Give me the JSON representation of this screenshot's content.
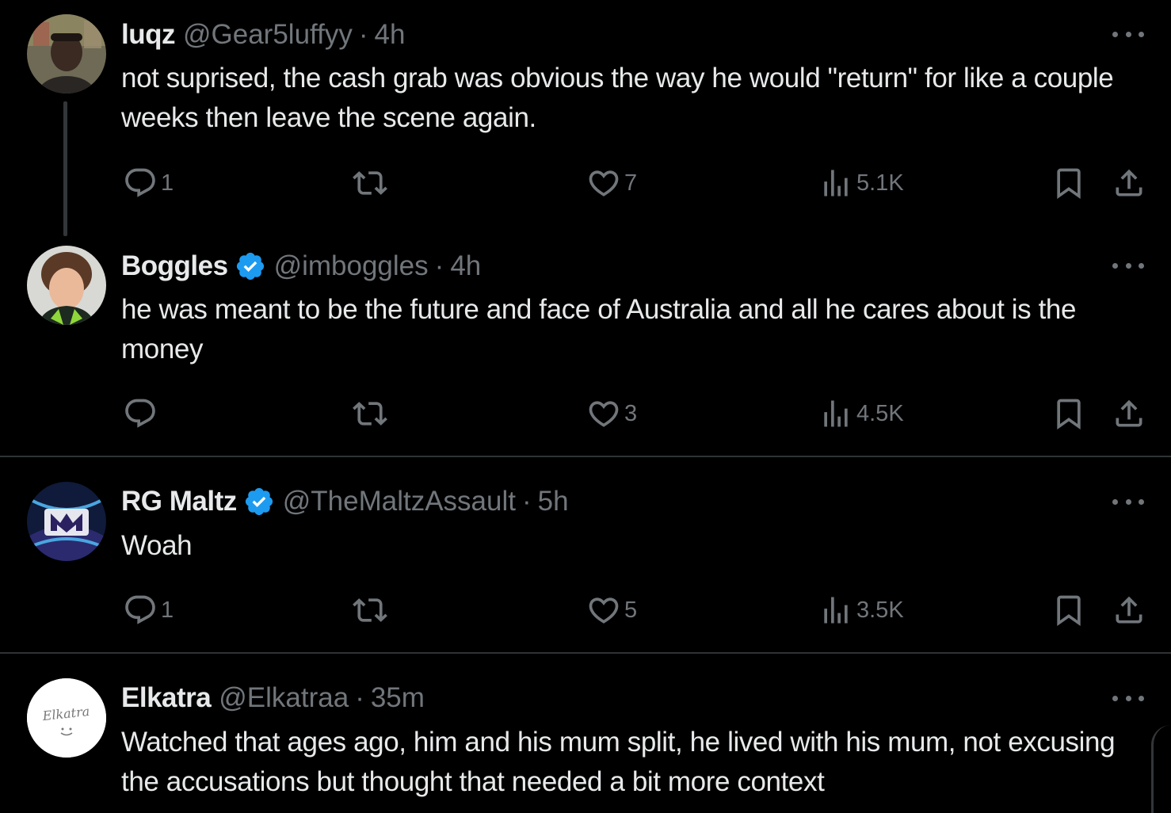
{
  "tweets": [
    {
      "name": "luqz",
      "handle": "@Gear5luffyy",
      "time": "4h",
      "verified": false,
      "text": "not suprised, the cash grab was obvious the way he would \"return\" for like a couple weeks then leave the scene again.",
      "replies": "1",
      "retweets": "",
      "likes": "7",
      "views": "5.1K"
    },
    {
      "name": "Boggles",
      "handle": "@imboggles",
      "time": "4h",
      "verified": true,
      "text": "he was meant to be the future and face of Australia and all he cares about is the money",
      "replies": "",
      "retweets": "",
      "likes": "3",
      "views": "4.5K"
    },
    {
      "name": "RG Maltz",
      "handle": "@TheMaltzAssault",
      "time": "5h",
      "verified": true,
      "text": "Woah",
      "replies": "1",
      "retweets": "",
      "likes": "5",
      "views": "3.5K"
    },
    {
      "name": "Elkatra",
      "handle": "@Elkatraa",
      "time": "35m",
      "verified": false,
      "text": "Watched that ages ago, him and his mum split, he lived with his mum, not excusing the accusations but thought that needed a bit more context",
      "avatar_text": "Elkatra"
    }
  ],
  "separator": "·",
  "colors": {
    "background": "#000000",
    "text": "#e7e9ea",
    "secondary": "#71767b",
    "verified": "#1d9bf0",
    "divider": "#2f3336"
  },
  "icons": [
    "reply-icon",
    "retweet-icon",
    "like-icon",
    "views-icon",
    "bookmark-icon",
    "share-icon",
    "more-icon",
    "verified-badge-icon"
  ]
}
